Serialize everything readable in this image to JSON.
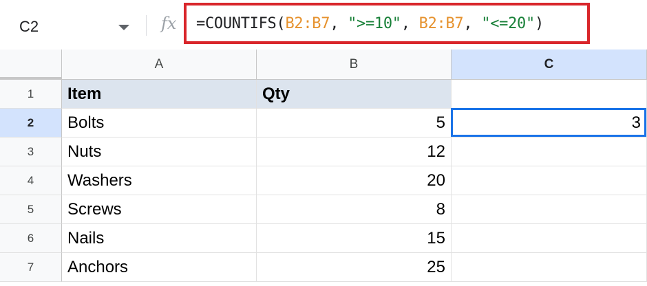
{
  "name_box": {
    "ref": "C2"
  },
  "formula_bar": {
    "fx_label": "fx",
    "formula_parts": [
      {
        "text": "=COUNTIFS(",
        "kind": "plain"
      },
      {
        "text": "B2:B7",
        "kind": "range"
      },
      {
        "text": ", ",
        "kind": "plain"
      },
      {
        "text": "\">=10\"",
        "kind": "string"
      },
      {
        "text": ", ",
        "kind": "plain"
      },
      {
        "text": "B2:B7",
        "kind": "range"
      },
      {
        "text": ", ",
        "kind": "plain"
      },
      {
        "text": "\"<=20\"",
        "kind": "string"
      },
      {
        "text": ")",
        "kind": "plain"
      }
    ],
    "highlight_color": "#d9262b"
  },
  "columns": [
    "A",
    "B",
    "C"
  ],
  "selected_column": "C",
  "rows": [
    {
      "num": "1",
      "a": "Item",
      "b": "Qty",
      "c": ""
    },
    {
      "num": "2",
      "a": "Bolts",
      "b": "5",
      "c": "3"
    },
    {
      "num": "3",
      "a": "Nuts",
      "b": "12",
      "c": ""
    },
    {
      "num": "4",
      "a": "Washers",
      "b": "20",
      "c": ""
    },
    {
      "num": "5",
      "a": "Screws",
      "b": "8",
      "c": ""
    },
    {
      "num": "6",
      "a": "Nails",
      "b": "15",
      "c": ""
    },
    {
      "num": "7",
      "a": "Anchors",
      "b": "25",
      "c": ""
    }
  ],
  "selected_row": "2",
  "colors": {
    "header_fill": "#dce4ee",
    "selection": "#1a73e8",
    "selected_header": "#d3e3fd"
  }
}
